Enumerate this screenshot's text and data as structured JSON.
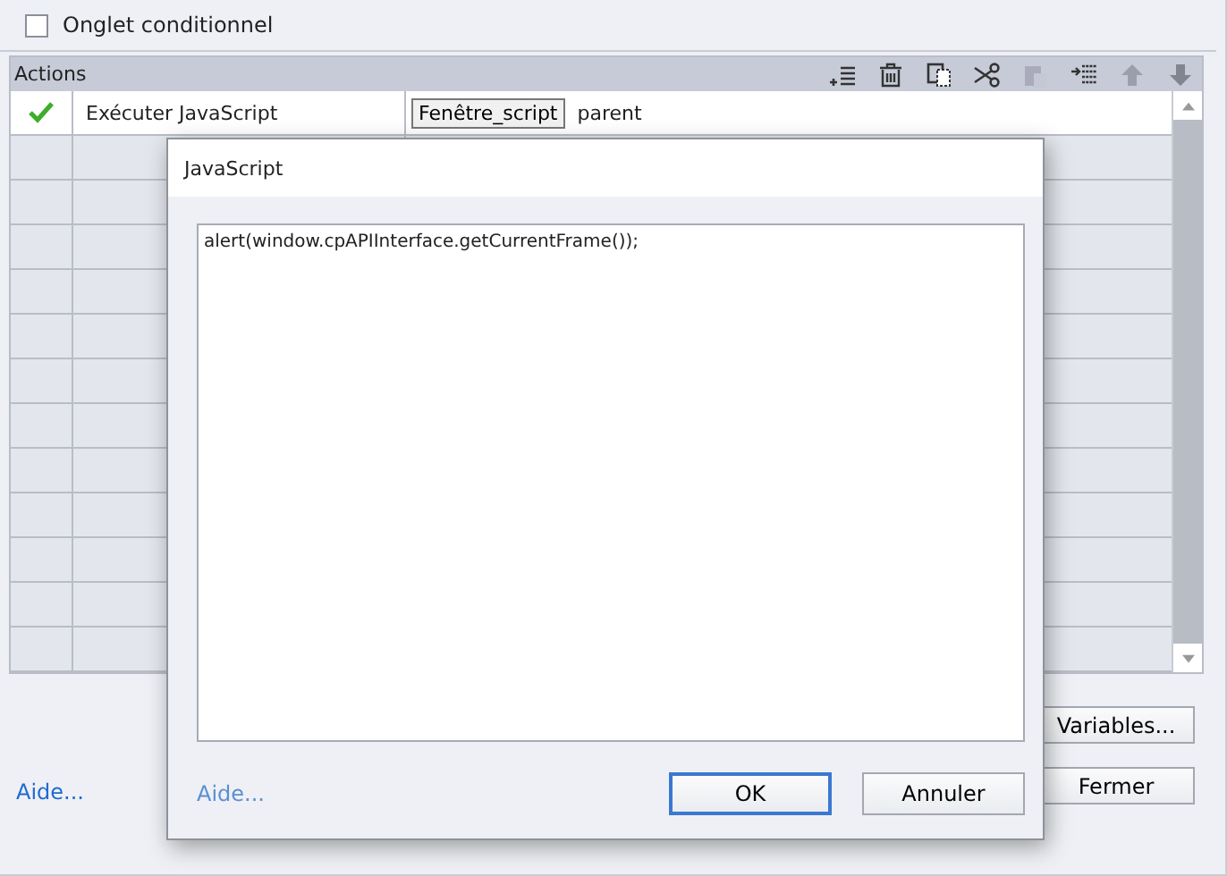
{
  "conditional_tab": {
    "label": "Onglet conditionnel",
    "checked": false
  },
  "actions": {
    "title": "Actions",
    "rows": [
      {
        "valid": true,
        "action": "Exécuter JavaScript",
        "button": "Fenêtre_script",
        "value": "parent"
      }
    ]
  },
  "variables_button": "Variables...",
  "close_button": "Fermer",
  "help_link": "Aide...",
  "dialog": {
    "title": "JavaScript",
    "code": "alert(window.cpAPIInterface.getCurrentFrame());",
    "help_link": "Aide...",
    "ok_button": "OK",
    "cancel_button": "Annuler"
  }
}
